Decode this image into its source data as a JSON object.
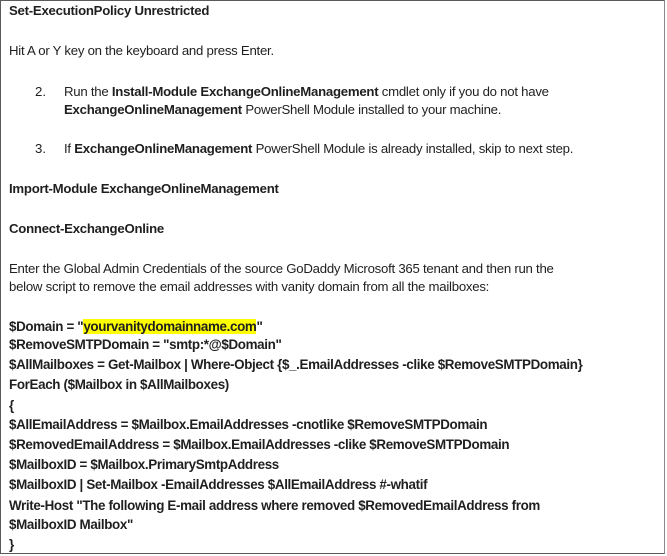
{
  "doc": {
    "cmd_policy": "Set-ExecutionPolicy Unrestricted",
    "hit_key": "Hit A or Y key on the keyboard and press Enter.",
    "step2": {
      "number": "2.",
      "pre": "Run the ",
      "cmdlet": "Install-Module ExchangeOnlineManagement",
      "post": " cmdlet only if you do not have",
      "module": "ExchangeOnlineManagement",
      "tail": "  PowerShell Module installed to your machine."
    },
    "step3": {
      "number": "3.",
      "pre": "If ",
      "module": "ExchangeOnlineManagement",
      "post": " PowerShell Module is already installed, skip to next step."
    },
    "cmd_import": "Import-Module ExchangeOnlineManagement",
    "cmd_connect": "Connect-ExchangeOnline",
    "intro_line1": "Enter the Global Admin Credentials of the source GoDaddy Microsoft 365 tenant and then run the",
    "intro_line2": "below script to remove the email addresses with vanity domain from all the mailboxes:",
    "script": {
      "domain_pre": "$Domain = \"",
      "domain_value": "yourvanitydomainname.com",
      "domain_post": "\"",
      "lines": [
        "$RemoveSMTPDomain = \"smtp:*@$Domain\"",
        "$AllMailboxes = Get-Mailbox | Where-Object {$_.EmailAddresses -clike $RemoveSMTPDomain}",
        "ForEach ($Mailbox in $AllMailboxes)",
        "{",
        "$AllEmailAddress  = $Mailbox.EmailAddresses -cnotlike $RemoveSMTPDomain",
        "$RemovedEmailAddress = $Mailbox.EmailAddresses -clike $RemoveSMTPDomain",
        "$MailboxID = $Mailbox.PrimarySmtpAddress",
        "$MailboxID | Set-Mailbox -EmailAddresses $AllEmailAddress #-whatif",
        "Write-Host \"The following E-mail address where removed $RemovedEmailAddress from",
        "$MailboxID Mailbox\"",
        "}"
      ]
    },
    "colors": {
      "highlight": "#ffff00",
      "text": "#1f1f1f",
      "border": "#5a5a5a"
    }
  }
}
